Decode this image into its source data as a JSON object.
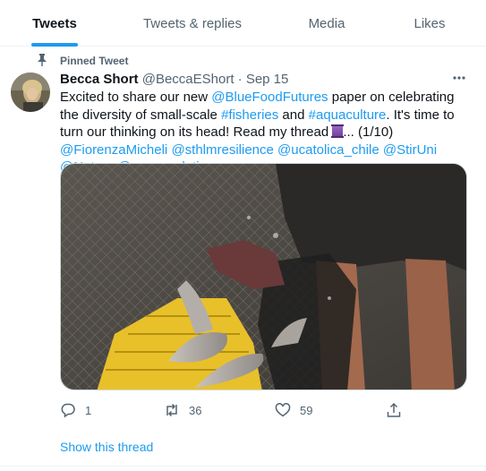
{
  "tabs": [
    {
      "label": "Tweets",
      "active": true
    },
    {
      "label": "Tweets & replies",
      "active": false
    },
    {
      "label": "Media",
      "active": false
    },
    {
      "label": "Likes",
      "active": false
    }
  ],
  "pinned_label": "Pinned Tweet",
  "tweet": {
    "author": "Becca Short",
    "handle_date": "@BeccaEShort · Sep 15",
    "text": {
      "t1": "Excited to share our new ",
      "m1": "@BlueFoodFutures",
      "t2": " paper on celebrating the diversity of small-scale ",
      "h1": "#fisheries",
      "t3": " and ",
      "h2": "#aquaculture",
      "t4": ". It's time to turn our thinking on its head! Read my thread ",
      "t5": "... (1/10) ",
      "m2": "@FiorenzaMicheli",
      "m3": "@sthlmresilience",
      "m4": "@ucatolica_chile",
      "m5": "@StirUni",
      "m6": "@Nature",
      "m7": "@oceansolutions"
    },
    "stats": {
      "replies": "1",
      "retweets": "36",
      "likes": "59"
    },
    "show_thread": "Show this thread"
  },
  "colors": {
    "accent": "#1d9bf0",
    "muted": "#536471",
    "text": "#0f1419"
  },
  "icons": [
    "pin-icon",
    "more-icon",
    "reply-icon",
    "retweet-icon",
    "like-icon",
    "share-icon",
    "thread-emoji-icon"
  ]
}
